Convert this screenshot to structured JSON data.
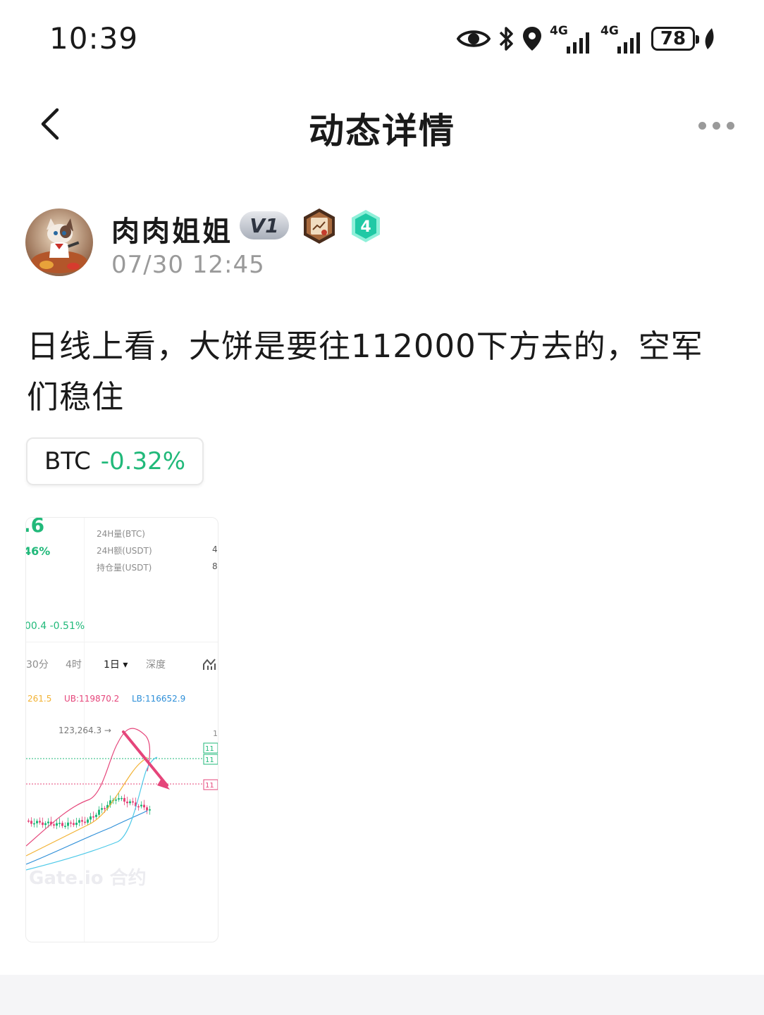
{
  "status_bar": {
    "time": "10:39",
    "network_1": "4G",
    "network_2": "4G",
    "battery": "78",
    "icons": [
      "eye-icon",
      "bluetooth-icon",
      "location-icon",
      "signal-icon",
      "signal-icon",
      "battery-icon",
      "leaf-icon"
    ]
  },
  "nav": {
    "title": "动态详情",
    "back_icon": "chevron-left-icon",
    "more_icon": "more-dots-icon"
  },
  "author": {
    "name": "肉肉姐姐",
    "vip_label": "V1",
    "level": "4",
    "time": "07/30 12:45"
  },
  "post": {
    "text": "日线上看，大饼是要往112000下方去的，空军们稳住",
    "coin": {
      "symbol": "BTC",
      "change": "-0.32%",
      "change_color": "#21b97a"
    }
  },
  "image": {
    "big_value": ".6",
    "pct": "46%",
    "stats": [
      "24H量(BTC)",
      "24H额(USDT)",
      "持仓量(USDT)"
    ],
    "stat_edges": [
      "4",
      "8"
    ],
    "price_line": "00.4  -0.51%",
    "tabs": [
      "30分",
      "4时",
      "1日 ▾",
      "深度"
    ],
    "indicator_1": "261.5",
    "indicator_2": "UB:119870.2",
    "indicator_3": "LB:116652.9",
    "peak_label": "123,264.3 →",
    "right_tick": "1",
    "price_tag_1": "11",
    "price_tag_2": "11",
    "price_tag_3": "11",
    "watermark": "Gate.io 合约",
    "colors": {
      "up": "#21b97a",
      "down": "#e5457a",
      "mid_line": "#f2b233",
      "upper_band": "#e5457a",
      "lower_band": "#2e8fd8",
      "ma": "#4dc9e8"
    }
  }
}
